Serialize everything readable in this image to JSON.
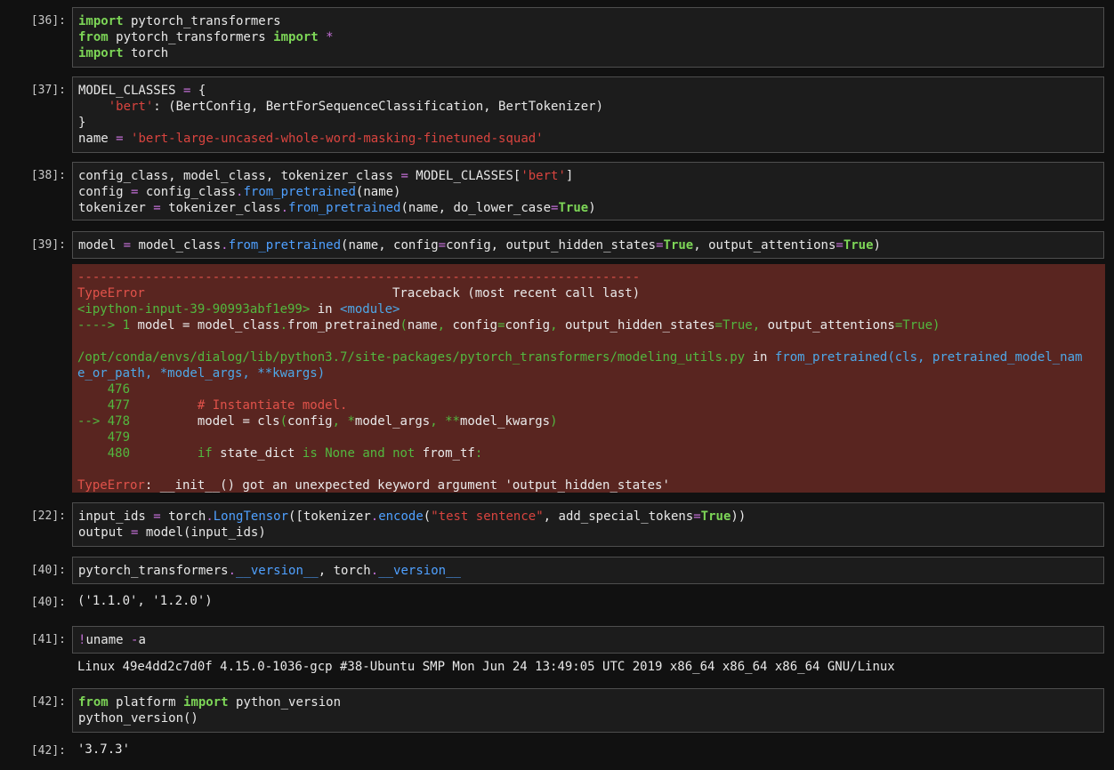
{
  "cells": [
    {
      "prompt": "[36]:",
      "lines": [
        [
          [
            "import",
            "kw"
          ],
          [
            " pytorch_transformers",
            ""
          ]
        ],
        [
          [
            "from",
            "kw"
          ],
          [
            " pytorch_transformers ",
            ""
          ],
          [
            "import",
            "kw"
          ],
          [
            " ",
            ""
          ],
          [
            "*",
            "op"
          ]
        ],
        [
          [
            "import",
            "kw"
          ],
          [
            " torch",
            ""
          ]
        ]
      ]
    },
    {
      "prompt": "[37]:",
      "lines": [
        [
          [
            "MODEL_CLASSES ",
            ""
          ],
          [
            "=",
            "op"
          ],
          [
            " {",
            ""
          ]
        ],
        [
          [
            "    ",
            ""
          ],
          [
            "'bert'",
            "str"
          ],
          [
            ": (BertConfig, BertForSequenceClassification, BertTokenizer)",
            ""
          ]
        ],
        [
          [
            "}",
            ""
          ]
        ],
        [
          [
            "name ",
            ""
          ],
          [
            "=",
            "op"
          ],
          [
            " ",
            ""
          ],
          [
            "'bert-large-uncased-whole-word-masking-finetuned-squad'",
            "str"
          ]
        ]
      ]
    },
    {
      "prompt": "[38]:",
      "lines": [
        [
          [
            "config_class, model_class, tokenizer_class ",
            ""
          ],
          [
            "=",
            "op"
          ],
          [
            " MODEL_CLASSES[",
            ""
          ],
          [
            "'bert'",
            "str"
          ],
          [
            "]",
            ""
          ]
        ],
        [
          [
            "config ",
            ""
          ],
          [
            "=",
            "op"
          ],
          [
            " config_class",
            ""
          ],
          [
            ".",
            "op"
          ],
          [
            "from_pretrained",
            "fn"
          ],
          [
            "(name)",
            ""
          ]
        ],
        [
          [
            "tokenizer ",
            ""
          ],
          [
            "=",
            "op"
          ],
          [
            " tokenizer_class",
            ""
          ],
          [
            ".",
            "op"
          ],
          [
            "from_pretrained",
            "fn"
          ],
          [
            "(name, do_lower_case",
            ""
          ],
          [
            "=",
            "op"
          ],
          [
            "True",
            "tr"
          ],
          [
            ")",
            ""
          ]
        ]
      ]
    },
    {
      "prompt": "[39]:",
      "lines": [
        [
          [
            "model ",
            ""
          ],
          [
            "=",
            "op"
          ],
          [
            " model_class",
            ""
          ],
          [
            ".",
            "op"
          ],
          [
            "from_pretrained",
            "fn"
          ],
          [
            "(name, config",
            ""
          ],
          [
            "=",
            "op"
          ],
          [
            "config, output_hidden_states",
            ""
          ],
          [
            "=",
            "op"
          ],
          [
            "True",
            "tr"
          ],
          [
            ", output_attentions",
            ""
          ],
          [
            "=",
            "op"
          ],
          [
            "True",
            "tr"
          ],
          [
            ")",
            ""
          ]
        ]
      ]
    },
    {
      "prompt": "[22]:",
      "lines": [
        [
          [
            "input_ids ",
            ""
          ],
          [
            "=",
            "op"
          ],
          [
            " torch",
            ""
          ],
          [
            ".",
            "op"
          ],
          [
            "LongTensor",
            "fn"
          ],
          [
            "([tokenizer",
            ""
          ],
          [
            ".",
            "op"
          ],
          [
            "encode",
            "fn"
          ],
          [
            "(",
            ""
          ],
          [
            "\"test sentence\"",
            "str"
          ],
          [
            ", add_special_tokens",
            ""
          ],
          [
            "=",
            "op"
          ],
          [
            "True",
            "tr"
          ],
          [
            "))",
            ""
          ]
        ],
        [
          [
            "output ",
            ""
          ],
          [
            "=",
            "op"
          ],
          [
            " model(input_ids)",
            ""
          ]
        ]
      ]
    },
    {
      "prompt": "[40]:",
      "lines": [
        [
          [
            "pytorch_transformers",
            ""
          ],
          [
            ".",
            "op"
          ],
          [
            "__version__",
            "fn"
          ],
          [
            ", torch",
            ""
          ],
          [
            ".",
            "op"
          ],
          [
            "__version__",
            "fn"
          ]
        ]
      ]
    },
    {
      "prompt": "[41]:",
      "lines": [
        [
          [
            "!",
            "op"
          ],
          [
            "uname ",
            ""
          ],
          [
            "-",
            "op"
          ],
          [
            "a",
            ""
          ]
        ]
      ]
    },
    {
      "prompt": "[42]:",
      "lines": [
        [
          [
            "from",
            "kw"
          ],
          [
            " platform ",
            ""
          ],
          [
            "import",
            "kw"
          ],
          [
            " python_version",
            ""
          ]
        ],
        [
          [
            "python_version()",
            ""
          ]
        ]
      ]
    }
  ],
  "error": {
    "dashes": "---------------------------------------------------------------------------",
    "lines": [
      [
        [
          "TypeError",
          "red"
        ],
        [
          "                                 Traceback (most recent call last)",
          ""
        ]
      ],
      [
        [
          "<ipython-input-39-90993abf1e99>",
          "grn"
        ],
        [
          " in ",
          ""
        ],
        [
          "<module>",
          "cyn"
        ]
      ],
      [
        [
          "----> 1 ",
          "grn"
        ],
        [
          "model = model_class",
          ""
        ],
        [
          ".",
          "grn"
        ],
        [
          "from_pretrained",
          ""
        ],
        [
          "(",
          "grn"
        ],
        [
          "name",
          ""
        ],
        [
          ",",
          "grn"
        ],
        [
          " config",
          ""
        ],
        [
          "=",
          "grn"
        ],
        [
          "config",
          ""
        ],
        [
          ",",
          "grn"
        ],
        [
          " output_hidden_states",
          ""
        ],
        [
          "=",
          "grn"
        ],
        [
          "True",
          "grn"
        ],
        [
          ",",
          "grn"
        ],
        [
          " output_attentions",
          ""
        ],
        [
          "=",
          "grn"
        ],
        [
          "True",
          "grn"
        ],
        [
          ")",
          "grn"
        ]
      ],
      [
        [
          "",
          ""
        ]
      ],
      [
        [
          "/opt/conda/envs/dialog/lib/python3.7/site-packages/pytorch_transformers/modeling_utils.py",
          "grn"
        ],
        [
          " in ",
          ""
        ],
        [
          "from_pretrained",
          "cyn"
        ],
        [
          "(cls, pretrained_model_nam",
          "cyn"
        ]
      ],
      [
        [
          "e_or_path, *model_args, **kwargs)",
          "cyn"
        ]
      ],
      [
        [
          "    476",
          "grn"
        ]
      ],
      [
        [
          "    477",
          "grn"
        ],
        [
          "         ",
          ""
        ],
        [
          "# Instantiate model.",
          "red"
        ]
      ],
      [
        [
          "--> 478",
          "grn"
        ],
        [
          "         model = cls",
          ""
        ],
        [
          "(",
          "grn"
        ],
        [
          "config",
          ""
        ],
        [
          ",",
          "grn"
        ],
        [
          " ",
          ""
        ],
        [
          "*",
          "grn"
        ],
        [
          "model_args",
          ""
        ],
        [
          ",",
          "grn"
        ],
        [
          " ",
          ""
        ],
        [
          "**",
          "grn"
        ],
        [
          "model_kwargs",
          ""
        ],
        [
          ")",
          "grn"
        ]
      ],
      [
        [
          "    479",
          "grn"
        ]
      ],
      [
        [
          "    480",
          "grn"
        ],
        [
          "         ",
          ""
        ],
        [
          "if",
          "grn"
        ],
        [
          " state_dict ",
          ""
        ],
        [
          "is",
          "grn"
        ],
        [
          " ",
          ""
        ],
        [
          "None",
          "grn"
        ],
        [
          " ",
          ""
        ],
        [
          "and",
          "grn"
        ],
        [
          " ",
          ""
        ],
        [
          "not",
          "grn"
        ],
        [
          " from_tf",
          ""
        ],
        [
          ":",
          "grn"
        ]
      ],
      [
        [
          "",
          ""
        ]
      ],
      [
        [
          "TypeError",
          "red"
        ],
        [
          ": __init__() got an unexpected keyword argument 'output_hidden_states'",
          ""
        ]
      ]
    ]
  },
  "outputs": [
    {
      "prompt": "[40]:",
      "text": "('1.1.0', '1.2.0')"
    },
    {
      "prompt": "",
      "text": "Linux 49e4dd2c7d0f 4.15.0-1036-gcp #38-Ubuntu SMP Mon Jun 24 13:49:05 UTC 2019 x86_64 x86_64 x86_64 GNU/Linux"
    },
    {
      "prompt": "[42]:",
      "text": "'3.7.3'"
    }
  ]
}
